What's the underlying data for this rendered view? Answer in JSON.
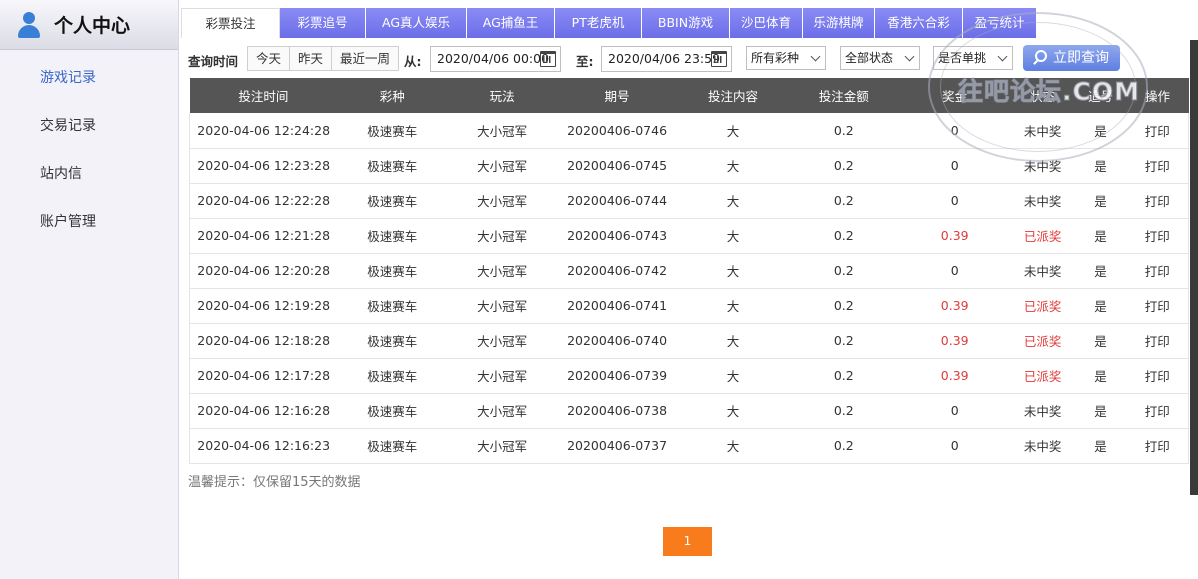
{
  "sidebar": {
    "title": "个人中心",
    "items": [
      {
        "label": "游戏记录"
      },
      {
        "label": "交易记录"
      },
      {
        "label": "站内信"
      },
      {
        "label": "账户管理"
      }
    ]
  },
  "tabs": [
    {
      "label": "彩票投注"
    },
    {
      "label": "彩票追号"
    },
    {
      "label": "AG真人娱乐"
    },
    {
      "label": "AG捕鱼王"
    },
    {
      "label": "PT老虎机"
    },
    {
      "label": "BBIN游戏"
    },
    {
      "label": "沙巴体育"
    },
    {
      "label": "乐游棋牌"
    },
    {
      "label": "香港六合彩"
    },
    {
      "label": "盈亏统计"
    }
  ],
  "filter": {
    "query_time_label": "查询时间",
    "quick": [
      "今天",
      "昨天",
      "最近一周"
    ],
    "from_label": "从:",
    "from_value": "2020/04/06 00:00",
    "to_label": "至:",
    "to_value": "2020/04/06 23:59",
    "lottery_select": "所有彩种",
    "status_select": "全部状态",
    "single_select": "是否单挑",
    "query_button": "立即查询"
  },
  "table": {
    "headers": [
      "投注时间",
      "彩种",
      "玩法",
      "期号",
      "投注内容",
      "投注金额",
      "奖金",
      "状态",
      "追号",
      "操作"
    ],
    "rows": [
      [
        "2020-04-06 12:24:28",
        "极速赛车",
        "大小冠军",
        "20200406-0746",
        "大",
        "0.2",
        "0",
        "未中奖",
        "是",
        "打印"
      ],
      [
        "2020-04-06 12:23:28",
        "极速赛车",
        "大小冠军",
        "20200406-0745",
        "大",
        "0.2",
        "0",
        "未中奖",
        "是",
        "打印"
      ],
      [
        "2020-04-06 12:22:28",
        "极速赛车",
        "大小冠军",
        "20200406-0744",
        "大",
        "0.2",
        "0",
        "未中奖",
        "是",
        "打印"
      ],
      [
        "2020-04-06 12:21:28",
        "极速赛车",
        "大小冠军",
        "20200406-0743",
        "大",
        "0.2",
        "0.39",
        "已派奖",
        "是",
        "打印"
      ],
      [
        "2020-04-06 12:20:28",
        "极速赛车",
        "大小冠军",
        "20200406-0742",
        "大",
        "0.2",
        "0",
        "未中奖",
        "是",
        "打印"
      ],
      [
        "2020-04-06 12:19:28",
        "极速赛车",
        "大小冠军",
        "20200406-0741",
        "大",
        "0.2",
        "0.39",
        "已派奖",
        "是",
        "打印"
      ],
      [
        "2020-04-06 12:18:28",
        "极速赛车",
        "大小冠军",
        "20200406-0740",
        "大",
        "0.2",
        "0.39",
        "已派奖",
        "是",
        "打印"
      ],
      [
        "2020-04-06 12:17:28",
        "极速赛车",
        "大小冠军",
        "20200406-0739",
        "大",
        "0.2",
        "0.39",
        "已派奖",
        "是",
        "打印"
      ],
      [
        "2020-04-06 12:16:28",
        "极速赛车",
        "大小冠军",
        "20200406-0738",
        "大",
        "0.2",
        "0",
        "未中奖",
        "是",
        "打印"
      ],
      [
        "2020-04-06 12:16:23",
        "极速赛车",
        "大小冠军",
        "20200406-0737",
        "大",
        "0.2",
        "0",
        "未中奖",
        "是",
        "打印"
      ]
    ]
  },
  "tip": "温馨提示：仅保留15天的数据",
  "pagination": {
    "current": "1"
  },
  "watermark": {
    "text": "往吧论坛.COM"
  },
  "colors": {
    "tab_bg": "#7a7cf0",
    "header_bg": "#555555",
    "accent_red": "#e03a3a",
    "pager_bg": "#f97c1c",
    "query_btn": "#6f8ce6"
  }
}
